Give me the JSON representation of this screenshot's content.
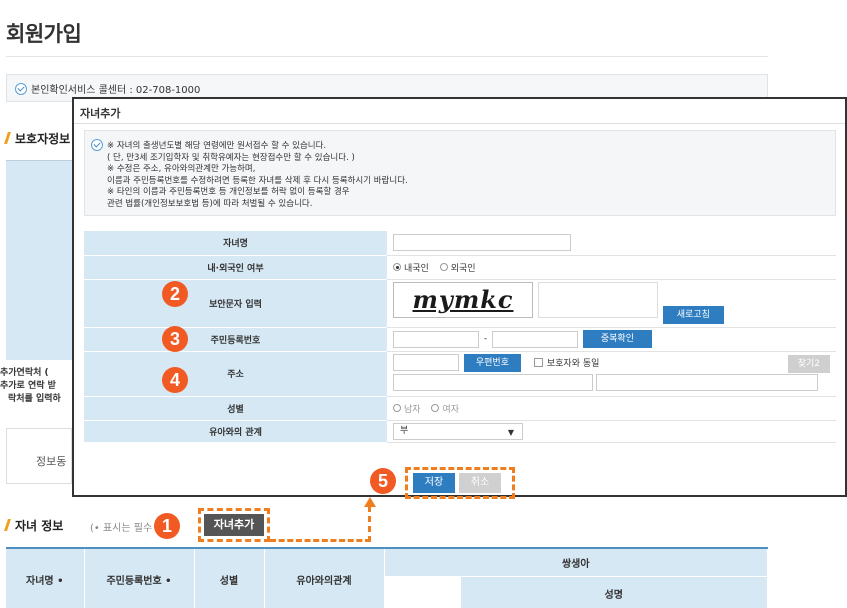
{
  "page": {
    "title": "회원가입",
    "verification_center": "본인확인서비스 콜센터 : 02-708-1000"
  },
  "guardian_section": {
    "title": "보호자정보",
    "extra_contact_lines": [
      "추가연락처 (",
      "추가로 연락 받",
      "락처를 입력하"
    ],
    "info_text": "정보동"
  },
  "child_section": {
    "title": "자녀 정보",
    "note": "(• 표시는 필수",
    "add_button": "자녀추가",
    "table": {
      "headers": [
        "자녀명  •",
        "주민등록번호  •",
        "성별",
        "유아와의관계"
      ],
      "twin_header": "쌍생아",
      "twin_sub_header": "성명"
    }
  },
  "modal": {
    "title": "자녀추가",
    "notice": [
      "※ 자녀의 출생년도별 해당 연령에만 원서접수 할 수 있습니다.",
      "( 단, 만3세 조기입학자 및 취학유예자는 현장접수만 할 수 있습니다. )",
      "※ 수정은 주소, 유아와의관계만 가능하며,",
      "이름과 주민등록번호를 수정하려면 등록한 자녀를 삭제 후 다시 등록하시기 바랍니다.",
      "※ 타인의 이름과 주민등록번호 등 개인정보를 허락 없이 등록할 경우",
      "관련 법률(개인정보보호법 등)에 따라 처벌될 수 있습니다."
    ],
    "form": {
      "name_label": "자녀명",
      "nationality_label": "내·외국인 여부",
      "nationality_options": [
        "내국인",
        "외국인"
      ],
      "captcha_label": "보안문자 입력",
      "captcha_text": "mymkc",
      "refresh_button": "새로고침",
      "rrn_label": "주민등록번호",
      "rrn_separator": "-",
      "duplicate_button": "중복확인",
      "address_label": "주소",
      "postal_button": "우편번호",
      "same_as_guardian": "보호자와 동일",
      "search2_button": "찾기2",
      "gender_label": "성별",
      "gender_options": [
        "남자",
        "여자"
      ],
      "relation_label": "유아와의 관계",
      "relation_value": "부"
    },
    "save_button": "저장",
    "cancel_button": "취소"
  },
  "annotations": {
    "step1": "1",
    "step2": "2",
    "step3": "3",
    "step4": "4",
    "step5": "5",
    "accent_color": "#f25a24",
    "dash_color": "#f07d1e"
  }
}
